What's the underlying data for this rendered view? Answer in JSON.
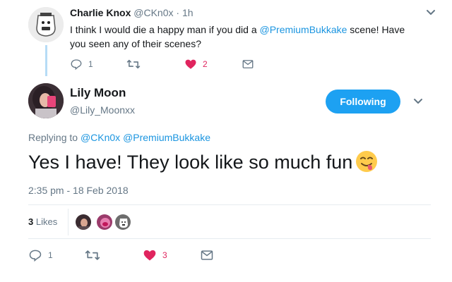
{
  "reply_tweet": {
    "name": "Charlie Knox",
    "handle": "@CKn0x",
    "separator": "·",
    "time": "1h",
    "text_before": "I think I would die a happy man if you did a ",
    "mention": "@PremiumBukkake",
    "text_after": " scene!  Have you seen any of their scenes?",
    "actions": {
      "reply_count": "1",
      "retweet_count": "",
      "like_count": "2"
    }
  },
  "main_tweet": {
    "name": "Lily Moon",
    "handle": "@Lily_Moonxx",
    "follow_label": "Following",
    "replying_prefix": "Replying to ",
    "replying_mention_1": "@CKn0x",
    "replying_mention_2": "@PremiumBukkake",
    "text": "Yes I have! They look like so much fun",
    "emoji": "smiling-face-with-tongue-emoji",
    "datetime": "2:35 pm - 18 Feb 2018",
    "likes_count": "3",
    "likes_label": "Likes",
    "actions": {
      "reply_count": "1",
      "retweet_count": "",
      "like_count": "3"
    }
  },
  "colors": {
    "accent": "#1da1f2",
    "link": "#1b95e0",
    "like": "#e0245e",
    "muted": "#657786",
    "thread_line": "#b6dcf6"
  }
}
